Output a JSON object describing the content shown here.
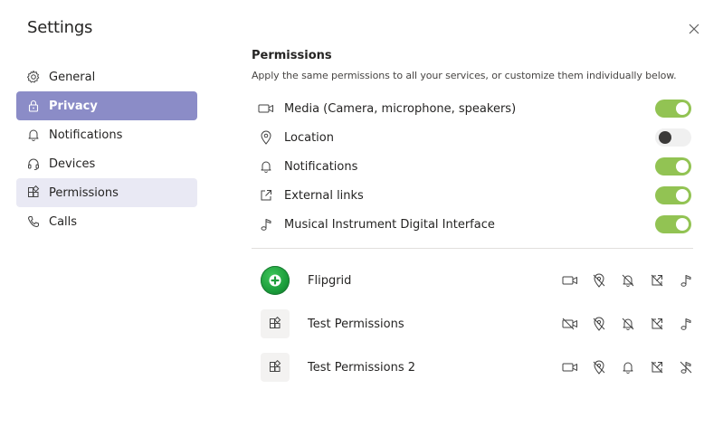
{
  "header": {
    "title": "Settings"
  },
  "sidebar": {
    "items": [
      {
        "label": "General",
        "icon": "gear-icon"
      },
      {
        "label": "Privacy",
        "icon": "lock-icon",
        "state": "active"
      },
      {
        "label": "Notifications",
        "icon": "bell-icon"
      },
      {
        "label": "Devices",
        "icon": "headset-icon"
      },
      {
        "label": "Permissions",
        "icon": "apps-icon",
        "state": "selected"
      },
      {
        "label": "Calls",
        "icon": "phone-icon"
      }
    ]
  },
  "permissions": {
    "title": "Permissions",
    "description": "Apply the same permissions to all your services, or customize them individually below.",
    "items": [
      {
        "label": "Media (Camera, microphone, speakers)",
        "icon": "camera-icon",
        "enabled": true
      },
      {
        "label": "Location",
        "icon": "location-pin-icon",
        "enabled": false
      },
      {
        "label": "Notifications",
        "icon": "bell-icon",
        "enabled": true
      },
      {
        "label": "External links",
        "icon": "external-link-icon",
        "enabled": true
      },
      {
        "label": "Musical Instrument Digital Interface",
        "icon": "music-note-icon",
        "enabled": true
      }
    ]
  },
  "apps": [
    {
      "name": "Flipgrid",
      "icon": "flipgrid-logo-icon",
      "perms": {
        "media": true,
        "location": false,
        "notifications": false,
        "links": false,
        "midi": true
      }
    },
    {
      "name": "Test Permissions",
      "icon": "app-blocks-icon",
      "perms": {
        "media": false,
        "location": false,
        "notifications": false,
        "links": false,
        "midi": true
      }
    },
    {
      "name": "Test Permissions 2",
      "icon": "app-blocks-icon",
      "perms": {
        "media": true,
        "location": false,
        "notifications": true,
        "links": false,
        "midi": false
      }
    }
  ],
  "colors": {
    "accent": "#8b8cc7",
    "toggle_on": "#92c353",
    "selected_bg": "#e9e9f4"
  }
}
